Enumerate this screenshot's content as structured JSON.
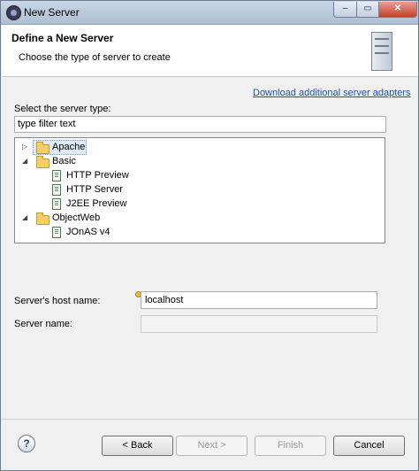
{
  "window": {
    "title": "New Server",
    "controls": {
      "minimize": "‒",
      "maximize": "▭",
      "close": "✕"
    }
  },
  "header": {
    "title": "Define a New Server",
    "description": "Choose the type of server to create"
  },
  "link": {
    "label": "Download additional server adapters"
  },
  "filter": {
    "label": "Select the server type:",
    "value": "type filter text"
  },
  "tree": {
    "apache": "Apache",
    "basic": "Basic",
    "http_preview": "HTTP Preview",
    "http_server": "HTTP Server",
    "j2ee_preview": "J2EE Preview",
    "objectweb": "ObjectWeb",
    "jonas": "JOnAS v4"
  },
  "fields": {
    "host_label": "Server's host name:",
    "host_value": "localhost",
    "name_label": "Server name:",
    "name_value": ""
  },
  "buttons": {
    "help": "?",
    "back": "< Back",
    "next": "Next >",
    "finish": "Finish",
    "cancel": "Cancel"
  }
}
